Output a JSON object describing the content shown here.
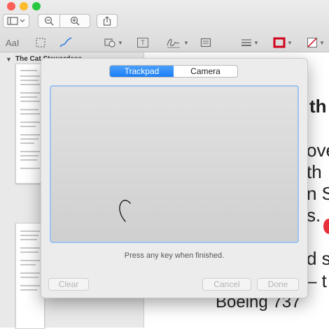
{
  "toolbar": {
    "buttons": [
      {
        "icon": "sidebar-toggle-icon"
      },
      {
        "icon": "zoom-out-icon"
      },
      {
        "icon": "zoom-in-icon"
      },
      {
        "icon": "share-icon"
      }
    ],
    "markup_tools": [
      {
        "icon": "text-style-icon",
        "label": "AaI"
      },
      {
        "icon": "rectangular-selection-icon"
      },
      {
        "icon": "sketch-icon"
      },
      {
        "icon": "shapes-icon"
      },
      {
        "icon": "text-box-icon",
        "label": "T"
      },
      {
        "icon": "signature-icon"
      },
      {
        "icon": "note-icon"
      },
      {
        "icon": "shape-style-icon"
      },
      {
        "icon": "border-color-icon"
      },
      {
        "icon": "fill-color-icon"
      }
    ],
    "colors": {
      "border_color": "#d0021b"
    }
  },
  "sidebar": {
    "doc_title": "The Cat Stewardess"
  },
  "document": {
    "lines": [
      "th",
      "ove",
      "th",
      "n S",
      "s.",
      "d s",
      "– t",
      "Boeing 737"
    ],
    "marker_color": "#e8303a"
  },
  "signature_panel": {
    "tabs": [
      {
        "label": "Trackpad",
        "active": true
      },
      {
        "label": "Camera",
        "active": false
      }
    ],
    "hint": "Press any key when finished.",
    "buttons": {
      "clear": "Clear",
      "cancel": "Cancel",
      "done": "Done"
    },
    "colors": {
      "accent": "#1a7ef5",
      "pad_border": "#9ec3f0"
    }
  }
}
